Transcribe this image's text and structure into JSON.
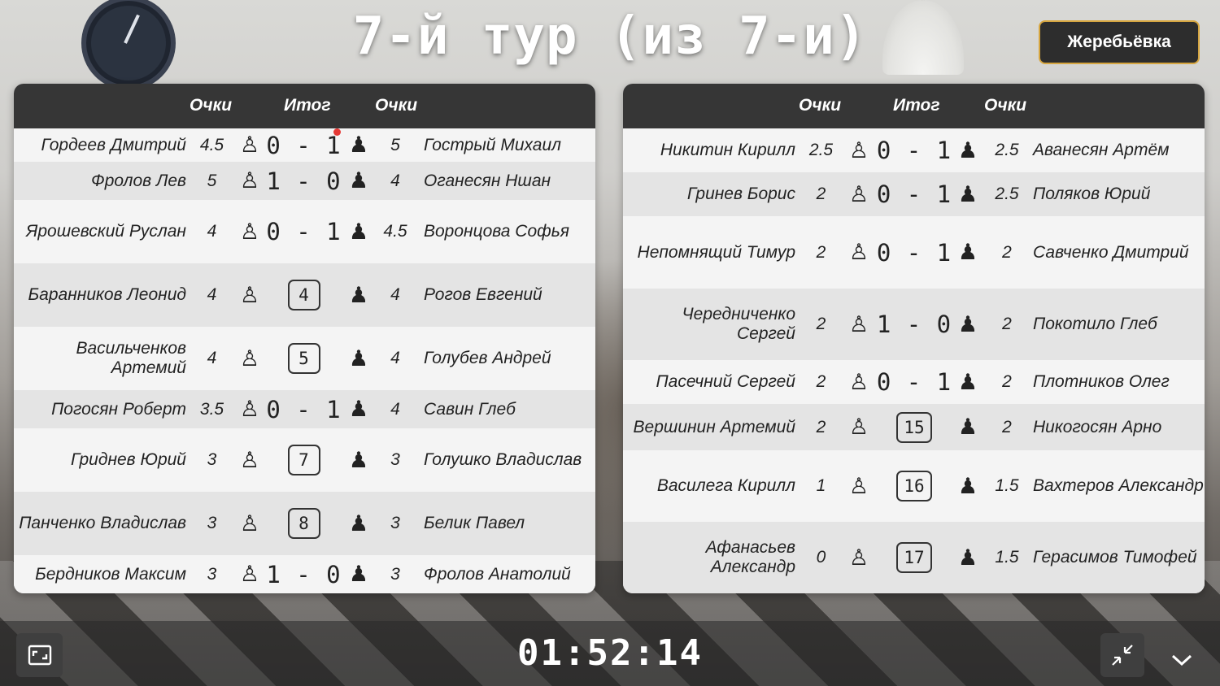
{
  "header": {
    "title": "7-й тур (из 7-и)",
    "draw_button": "Жеребьёвка"
  },
  "columns": {
    "points": "Очки",
    "result": "Итог",
    "points2": "Очки"
  },
  "left_table": {
    "rows": [
      {
        "white": "Гордеев Дмитрий",
        "wpts": "4.5",
        "result": "0 - 1",
        "board": null,
        "bpts": "5",
        "black": "Гострый Михаил",
        "dot": true
      },
      {
        "white": "Фролов Лев",
        "wpts": "5",
        "result": "1 - 0",
        "board": null,
        "bpts": "4",
        "black": "Оганесян Ншан"
      },
      {
        "white": "Ярошевский Руслан",
        "wpts": "4",
        "result": "0 - 1",
        "board": null,
        "bpts": "4.5",
        "black": "Воронцова Софья"
      },
      {
        "white": "Баранников Леонид",
        "wpts": "4",
        "result": null,
        "board": "4",
        "bpts": "4",
        "black": "Рогов Евгений"
      },
      {
        "white": "Васильченков Артемий",
        "wpts": "4",
        "result": null,
        "board": "5",
        "bpts": "4",
        "black": "Голубев Андрей"
      },
      {
        "white": "Погосян Роберт",
        "wpts": "3.5",
        "result": "0 - 1",
        "board": null,
        "bpts": "4",
        "black": "Савин Глеб"
      },
      {
        "white": "Гриднев Юрий",
        "wpts": "3",
        "result": null,
        "board": "7",
        "bpts": "3",
        "black": "Голушко Владислав"
      },
      {
        "white": "Панченко Владислав",
        "wpts": "3",
        "result": null,
        "board": "8",
        "bpts": "3",
        "black": "Белик Павел"
      },
      {
        "white": "Бердников Максим",
        "wpts": "3",
        "result": "1 - 0",
        "board": null,
        "bpts": "3",
        "black": "Фролов Анатолий"
      }
    ]
  },
  "right_table": {
    "rows": [
      {
        "white": "Никитин Кирилл",
        "wpts": "2.5",
        "result": "0 - 1",
        "board": null,
        "bpts": "2.5",
        "black": "Аванесян Артём"
      },
      {
        "white": "Гринев Борис",
        "wpts": "2",
        "result": "0 - 1",
        "board": null,
        "bpts": "2.5",
        "black": "Поляков Юрий"
      },
      {
        "white": "Непомнящий Тимур",
        "wpts": "2",
        "result": "0 - 1",
        "board": null,
        "bpts": "2",
        "black": "Савченко Дмитрий"
      },
      {
        "white": "Чередниченко Сергей",
        "wpts": "2",
        "result": "1 - 0",
        "board": null,
        "bpts": "2",
        "black": "Покотило Глеб"
      },
      {
        "white": "Пасечний Сергей",
        "wpts": "2",
        "result": "0 - 1",
        "board": null,
        "bpts": "2",
        "black": "Плотников Олег"
      },
      {
        "white": "Вершинин Артемий",
        "wpts": "2",
        "result": null,
        "board": "15",
        "bpts": "2",
        "black": "Никогосян Арно"
      },
      {
        "white": "Василега Кирилл",
        "wpts": "1",
        "result": null,
        "board": "16",
        "bpts": "1.5",
        "black": "Вахтеров Александр"
      },
      {
        "white": "Афанасьев Александр",
        "wpts": "0",
        "result": null,
        "board": "17",
        "bpts": "1.5",
        "black": "Герасимов Тимофей"
      }
    ]
  },
  "footer": {
    "timer": "01:52:14"
  },
  "icons": {
    "white_pawn": "♙",
    "black_pawn": "♟",
    "fullscreen": "fullscreen-icon",
    "collapse": "collapse-icon",
    "chevron": "chevron-down-icon"
  },
  "colors": {
    "header_bg": "#363636",
    "draw_button_border": "#d6a640",
    "live_dot": "#e53935"
  }
}
